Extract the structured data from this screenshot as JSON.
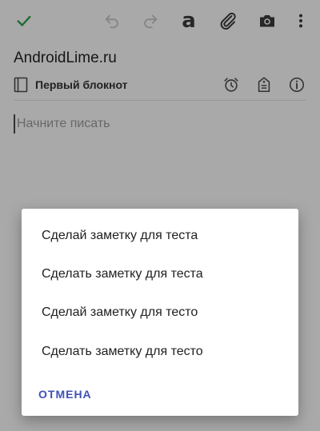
{
  "toolbar": {
    "icons": [
      "check-icon",
      "undo-icon",
      "redo-icon",
      "text-format-icon",
      "attachment-icon",
      "camera-icon",
      "more-vert-icon"
    ],
    "format_letter": "a",
    "colors": {
      "check": "#2e9d4b",
      "disabled": "#c4c4c4",
      "active": "#3a3a3a"
    }
  },
  "note": {
    "title": "AndroidLime.ru",
    "notebook": "Первый блокнот",
    "body_placeholder": "Начните писать"
  },
  "dialog": {
    "suggestions": [
      "Сделай заметку для теста",
      "Сделать заметку для теста",
      "Сделай заметку для тесто",
      "Сделать заметку для тесто"
    ],
    "cancel_label": "ОТМЕНА",
    "accent_color": "#3f51b5"
  }
}
